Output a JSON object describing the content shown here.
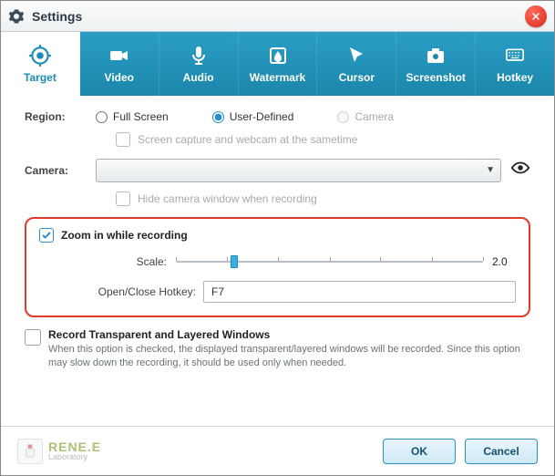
{
  "window": {
    "title": "Settings"
  },
  "tabs": [
    {
      "label": "Target"
    },
    {
      "label": "Video"
    },
    {
      "label": "Audio"
    },
    {
      "label": "Watermark"
    },
    {
      "label": "Cursor"
    },
    {
      "label": "Screenshot"
    },
    {
      "label": "Hotkey"
    }
  ],
  "region": {
    "label": "Region:",
    "options": {
      "fullscreen": "Full Screen",
      "userdefined": "User-Defined",
      "camera": "Camera"
    },
    "selected": "userdefined",
    "dualLabel": "Screen capture and webcam at the sametime"
  },
  "camera": {
    "label": "Camera:",
    "selected": "",
    "hideLabel": "Hide camera window when recording"
  },
  "zoom": {
    "checkLabel": "Zoom in while recording",
    "scaleLabel": "Scale:",
    "scaleValue": "2.0",
    "hotkeyLabel": "Open/Close Hotkey:",
    "hotkeyValue": "F7"
  },
  "layered": {
    "title": "Record Transparent and Layered Windows",
    "desc": "When this option is checked, the displayed transparent/layered windows will be recorded. Since this option may slow down the recording, it should be used only when needed."
  },
  "brand": {
    "line1": "RENE.E",
    "line2": "Laboratory"
  },
  "buttons": {
    "ok": "OK",
    "cancel": "Cancel"
  }
}
